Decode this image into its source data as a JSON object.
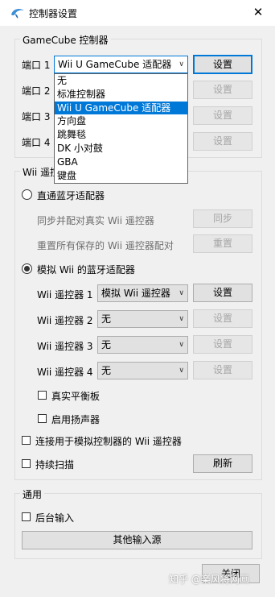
{
  "window": {
    "title": "控制器设置",
    "close_symbol": "✕"
  },
  "gamecube": {
    "title": "GameCube 控制器",
    "ports": [
      {
        "label": "端口 1",
        "value": "Wii U GameCube 适配器",
        "button": "设置"
      },
      {
        "label": "端口 2",
        "value": "",
        "button": "设置"
      },
      {
        "label": "端口 3",
        "value": "",
        "button": "设置"
      },
      {
        "label": "端口 4",
        "value": "",
        "button": "设置"
      }
    ],
    "dropdown_options": [
      "无",
      "标准控制器",
      "Wii U GameCube 适配器",
      "方向盘",
      "跳舞毯",
      "DK 小对鼓",
      "GBA",
      "键盘"
    ],
    "dropdown_selected": "Wii U GameCube 适配器"
  },
  "wii": {
    "title": "Wii 遥控器",
    "passthrough_label": "直通蓝牙适配器",
    "sync_label": "同步并配对真实 Wii 遥控器",
    "sync_button": "同步",
    "reset_label": "重置所有保存的 Wii 遥控器配对",
    "reset_button": "重置",
    "emulated_label": "模拟 Wii 的蓝牙适配器",
    "remotes": [
      {
        "label": "Wii 遥控器 1",
        "value": "模拟 Wii 遥控器",
        "button": "设置"
      },
      {
        "label": "Wii 遥控器 2",
        "value": "无",
        "button": "设置"
      },
      {
        "label": "Wii 遥控器 3",
        "value": "无",
        "button": "设置"
      },
      {
        "label": "Wii 遥控器 4",
        "value": "无",
        "button": "设置"
      }
    ],
    "balance_board": "真实平衡板",
    "speaker": "启用扬声器",
    "connect_label": "连接用于模拟控制器的 Wii 遥控器",
    "continuous_scan": "持续扫描",
    "refresh_button": "刷新"
  },
  "general": {
    "title": "通用",
    "background_input": "后台输入",
    "other_sources_button": "其他输入源"
  },
  "footer": {
    "close_button": "关闭"
  },
  "watermark": "知乎 @楽风将网画",
  "colors": {
    "accent": "#0078d7",
    "background": "#f0f0f0",
    "button": "#e1e1e1"
  },
  "icons": {
    "app": "dolphin-icon",
    "dropdown": "chevron-down-icon"
  }
}
